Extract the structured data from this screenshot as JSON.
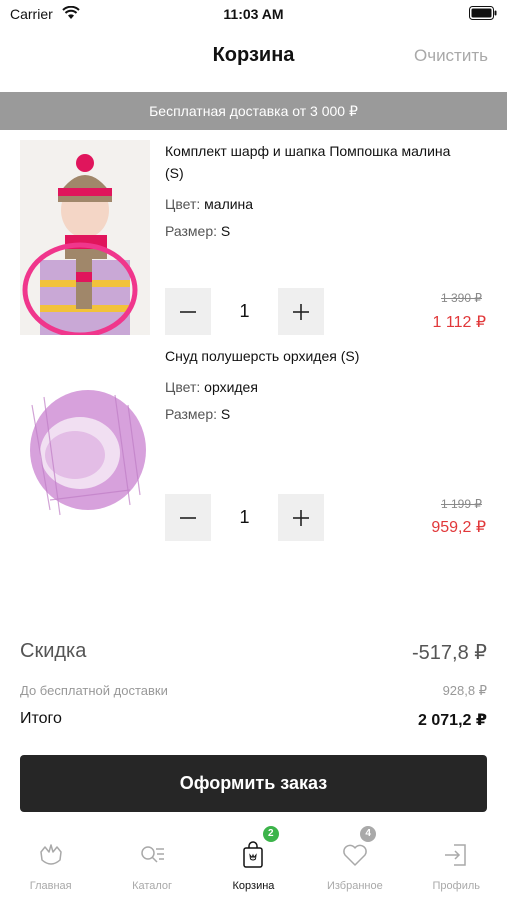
{
  "status_bar": {
    "carrier": "Carrier",
    "time": "11:03 AM"
  },
  "header": {
    "title": "Корзина",
    "clear_label": "Очистить"
  },
  "promo_banner": {
    "text": "Бесплатная доставка от 3 000 ₽"
  },
  "cart": {
    "items": [
      {
        "name": "Комплект шарф и шапка Помпошка малина (S)",
        "color_label": "Цвет:",
        "color_value": "малина",
        "size_label": "Размер:",
        "size_value": "S",
        "quantity": "1",
        "old_price": "1 390 ₽",
        "new_price": "1 112 ₽"
      },
      {
        "name": "Снуд полушерсть орхидея (S)",
        "color_label": "Цвет:",
        "color_value": "орхидея",
        "size_label": "Размер:",
        "size_value": "S",
        "quantity": "1",
        "old_price": "1 199 ₽",
        "new_price": "959,2 ₽"
      }
    ]
  },
  "summary": {
    "discount_label": "Скидка",
    "discount_value": "-517,8 ₽",
    "free_delivery_label": "До бесплатной доставки",
    "free_delivery_value": "928,8 ₽",
    "total_label": "Итого",
    "total_value": "2 071,2 ₽"
  },
  "checkout": {
    "label": "Оформить заказ"
  },
  "tab_bar": {
    "items": [
      {
        "label": "Главная",
        "icon": "home-icon"
      },
      {
        "label": "Каталог",
        "icon": "catalog-icon"
      },
      {
        "label": "Корзина",
        "icon": "cart-icon",
        "badge": "2",
        "badge_color": "#3cb44a"
      },
      {
        "label": "Избранное",
        "icon": "heart-icon",
        "badge": "4",
        "badge_color": "#a9a9a9"
      },
      {
        "label": "Профиль",
        "icon": "login-icon"
      }
    ]
  },
  "colors": {
    "accent_price": "#e1383a",
    "button_dark": "#262626",
    "banner_grey": "#9a9a9a"
  }
}
